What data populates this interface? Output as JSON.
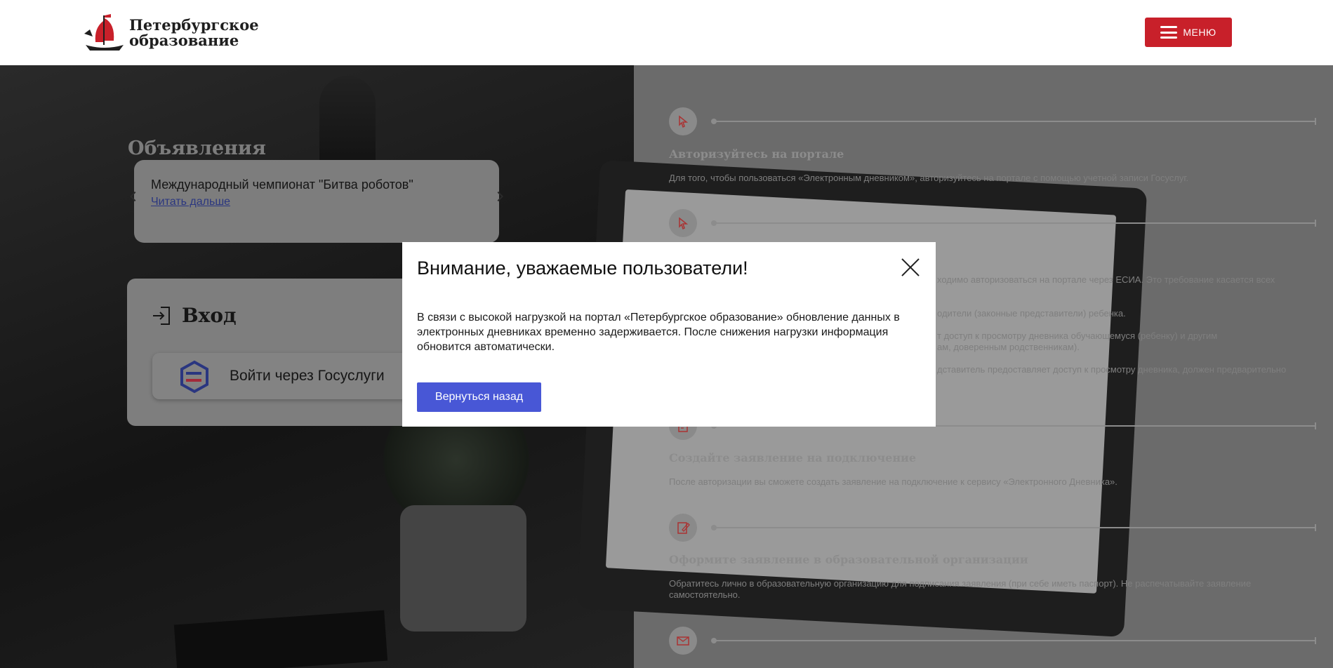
{
  "header": {
    "brand_line1": "Петербургское",
    "brand_line2": "образование",
    "menu_label": "МЕНЮ",
    "accent_color": "#c8202a"
  },
  "announcements": {
    "title": "Объявления",
    "items": [
      {
        "text": "Международный чемпионат \"Битва роботов\"",
        "link": "Читать дальше"
      }
    ]
  },
  "login": {
    "title": "Вход",
    "gosuslugi_button": "Войти через Госуслуги"
  },
  "steps": [
    {
      "icon": "cursor-click-icon",
      "title": "Авторизуйтесь на портале",
      "desc": "Для того, чтобы пользоваться «Электронным дневником», авторизуйтесь на портале с помощью учетной записи Госуслуг."
    },
    {
      "icon": "cursor-click-icon",
      "desc_lines": [
        "ходимо авторизоваться на портале через ЕСИА. Это требование касается всех",
        "одители (законные представители) ребенка.",
        "т доступ к просмотру дневника обучающемуся (ребенку) и другим",
        "ам, доверенным родственникам).",
        "дставитель предоставляет доступ к просмотру дневника, должен предварительно"
      ]
    },
    {
      "icon": "document-icon",
      "title": "Создайте заявление на подключение",
      "desc": "После авторизации вы сможете создать заявление на подключение к сервису «Электронного Дневника»."
    },
    {
      "icon": "sign-document-icon",
      "title": "Оформите заявление в образовательной организации",
      "desc": "Обратитесь лично в образовательную организацию для подписания заявления (при себе иметь паспорт). Не распечатывайте заявление самостоятельно."
    },
    {
      "icon": "mail-icon"
    }
  ],
  "modal": {
    "title": "Внимание, уважаемые пользователи!",
    "body": "В связи с  высокой нагрузкой на портал «Петербургское образование» обновление данных в электронных дневниках временно задерживается. После снижения нагрузки информация обновится автоматически.",
    "button": "Вернуться назад",
    "button_color": "#4857d6"
  }
}
